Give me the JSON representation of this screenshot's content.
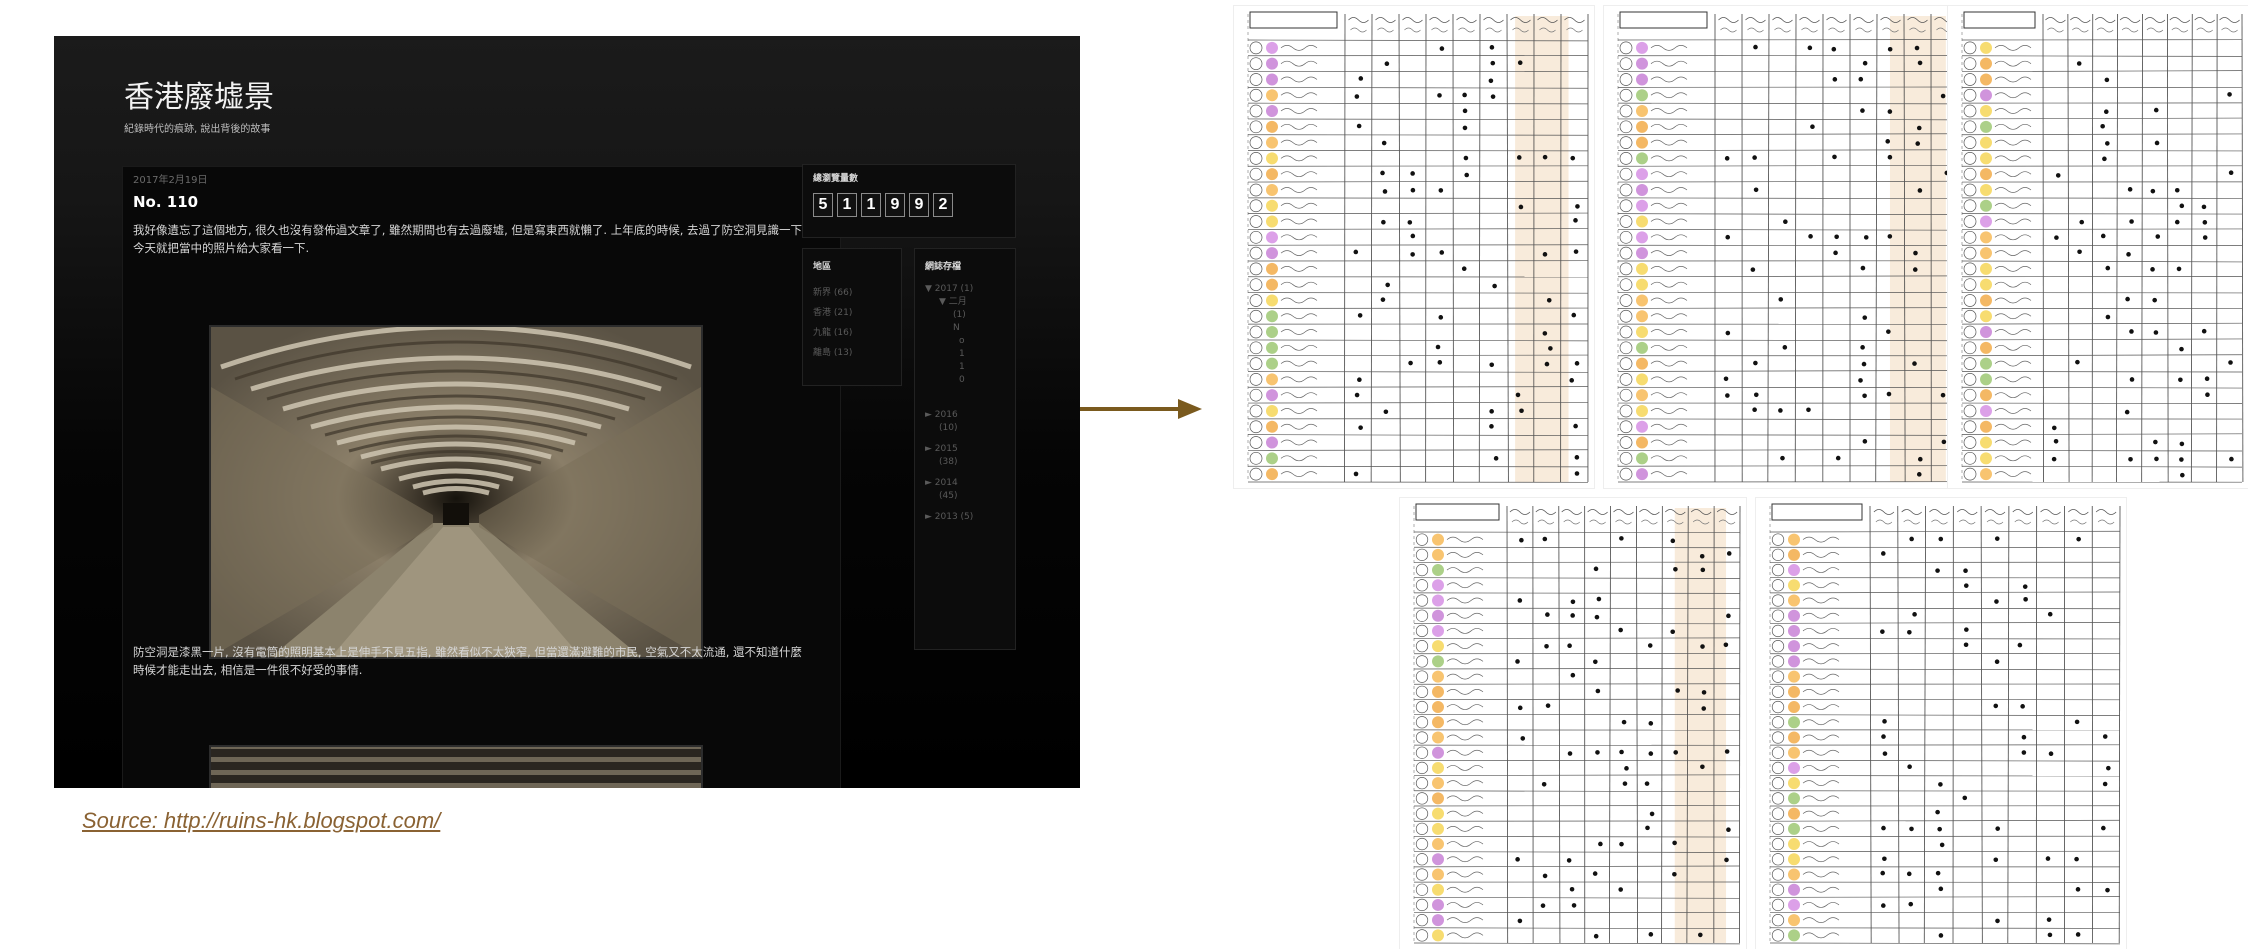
{
  "blog": {
    "title": "香港廢墟景",
    "description": "紀錄時代的痕跡, 說出背後的故事",
    "post_date": "2017年2月19日",
    "post_title": "No. 110",
    "paragraph1": "我好像遺忘了這個地方, 很久也沒有發佈過文章了, 雖然期間也有去過廢墟, 但是寫東西就懶了. 上年底的時候, 去過了防空洞見識一下, 今天就把當中的照片給大家看一下.",
    "paragraph2": "防空洞是漆黑一片, 沒有電筒的照明基本上是伸手不見五指, 雖然看似不太狹窄, 但當還滿避難的市民, 空氣又不太流通, 還不知道什麼時候才能走出去, 相信是一件很不好受的事情.",
    "counter_title": "總瀏覽量數",
    "counter_digits": [
      "5",
      "1",
      "1",
      "9",
      "9",
      "2"
    ],
    "labels_heading": "地區",
    "labels": [
      "新界 (66)",
      "香港 (21)",
      "九龍 (16)",
      "離島 (13)"
    ],
    "archive_heading": "網誌存檔",
    "archive_current": "▼ 2017 (1)",
    "archive_month": "▼ 二月",
    "archive_month_detail": [
      "(1)",
      "N",
      "o",
      "",
      "1",
      "1",
      "0"
    ],
    "archive_years": [
      "► 2016",
      "(10)",
      "► 2015",
      "(38)",
      "► 2014",
      "(45)",
      "► 2013 (5)"
    ]
  },
  "source_caption": "Source: http://ruins-hk.blogspot.com/",
  "colors": {
    "arrow": "#7a5a1e",
    "caption": "#8a6233",
    "blog_bg": "#0a0a0a"
  }
}
